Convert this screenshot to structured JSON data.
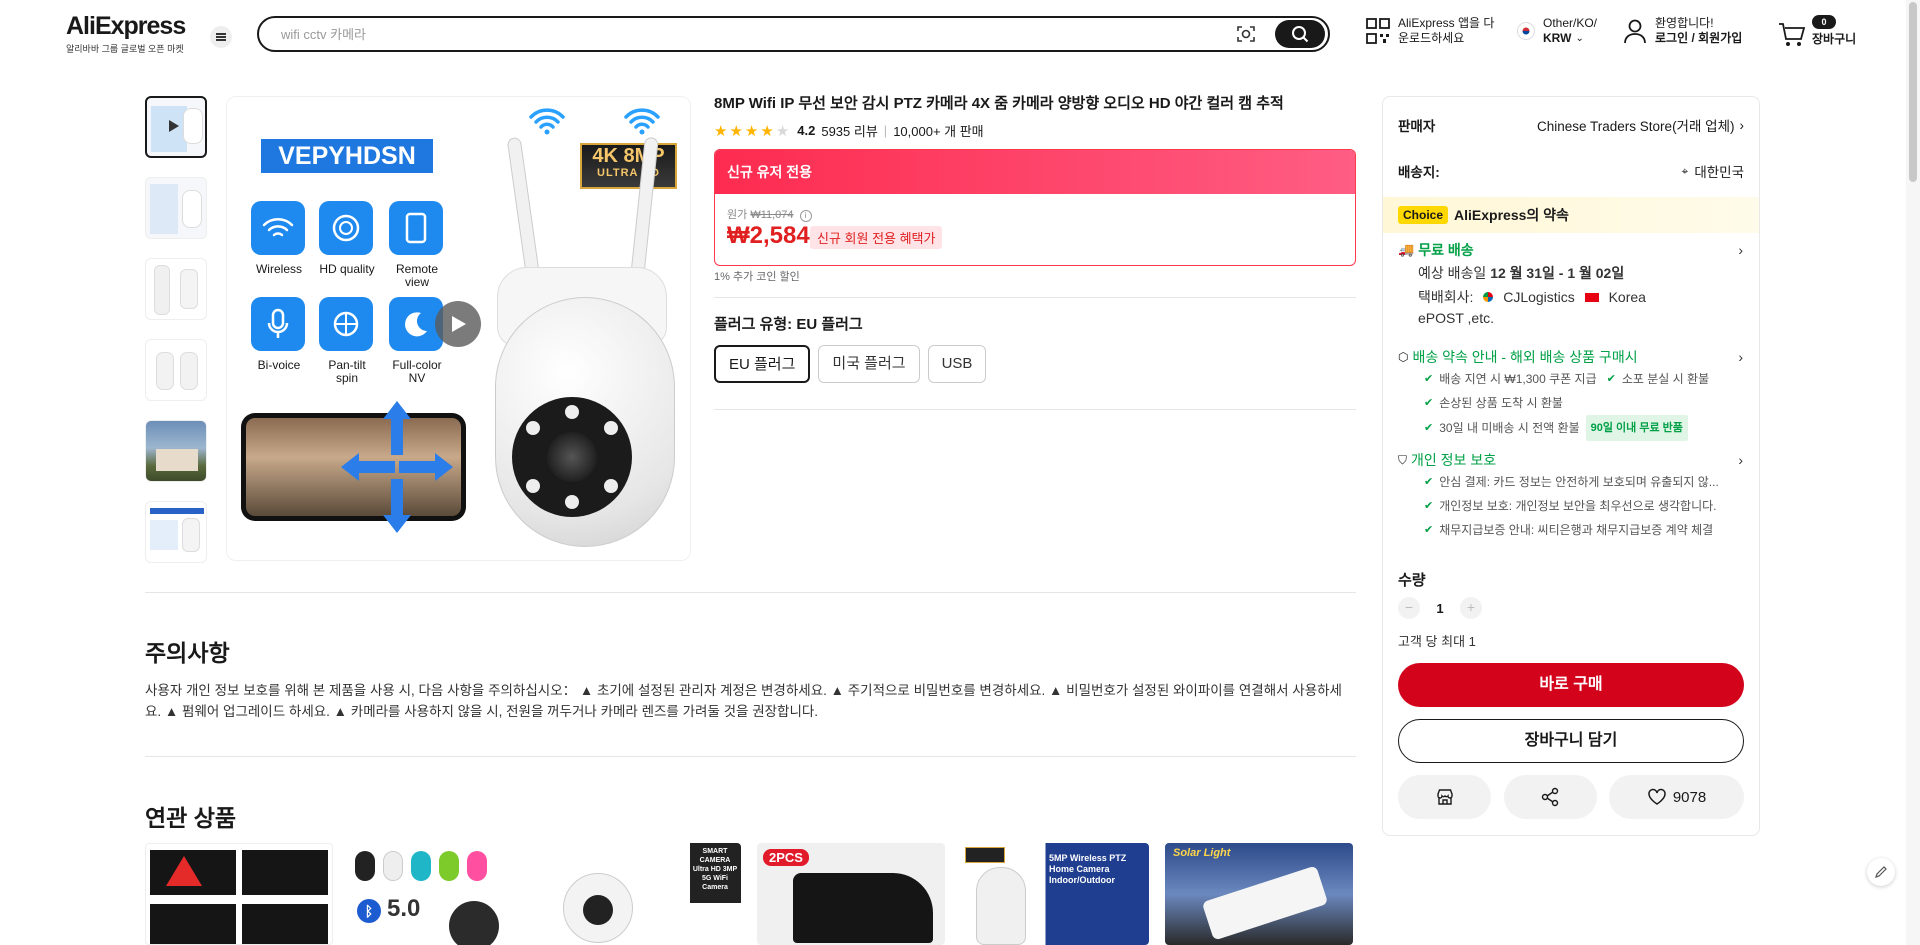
{
  "header": {
    "logo": "AliExpress",
    "logo_sub": "알리바바 그룹 글로벌 오픈 마켓",
    "search_placeholder": "wifi cctv 카메라",
    "app_line1": "AliExpress 앱을 다",
    "app_line2": "운로드하세요",
    "region_line1": "Other/KO/",
    "region_line2": "KRW",
    "account_line1": "환영합니다!",
    "account_line2": "로그인 / 회원가입",
    "cart_count": "0",
    "cart_label": "장바구니"
  },
  "gallery": {
    "brand": "VEPYHDSN",
    "badge_line1": "4K 8MP",
    "badge_line2": "ULTRA HD",
    "features": [
      "Wireless",
      "HD quality",
      "Remote view",
      "Bi-voice",
      "Pan-tilt spin",
      "Full-color NV"
    ]
  },
  "product": {
    "title": "8MP Wifi IP 무선 보안 감시 PTZ 카메라 4X 줌 카메라 양방향 오디오 HD 야간 컬러 캠 추적",
    "rating": "4.2",
    "rating_stars": 4,
    "reviews": "5935 리뷰",
    "sold": "10,000+ 개 판매",
    "promo_header": "신규 유저 전용",
    "orig_label": "원가",
    "orig_price": "₩11,074",
    "price": "₩2,584",
    "promo_tag": "신규 회원 전용 혜택가",
    "coin_note": "1% 추가 코인 할인",
    "plug_label": "플러그 유형: EU 플러그",
    "plug_options": [
      "EU 플러그",
      "미국 플러그",
      "USB"
    ],
    "plug_selected": 0
  },
  "notice": {
    "title": "주의사항",
    "text": "사용자 개인 정보 보호를 위해 본 제품을 사용 시, 다음 사항을 주의하십시오： ▲ 초기에 설정된 관리자 계정은 변경하세요. ▲ 주기적으로 비밀번호를 변경하세요. ▲ 비밀번호가 설정된 와이파이를 연결해서 사용하세요. ▲ 펌웨어 업그레이드 하세요. ▲ 카메라를 사용하지 않을 시, 전원을 꺼두거나 카메라 렌즈를 가려둘 것을 권장합니다."
  },
  "related": {
    "title": "연관 상품",
    "card_labels": [
      "",
      "5.0",
      "SMART CAMERA Ultra HD 3MP 5G WiFi Camera",
      "2PCS",
      "5MP Wireless PTZ Home Camera Indoor/Outdoor",
      "Solar Light"
    ]
  },
  "panel": {
    "seller_label": "판매자",
    "seller_name": "Chinese Traders Store(거래 업체)",
    "shipto_label": "배송지:",
    "shipto_value": "대한민국",
    "choice_badge": "Choice",
    "choice_text": "AliExpress의 약속",
    "free_ship": "무료 배송",
    "eta_prefix": "예상 배송일 ",
    "eta_dates": "12 월 31일 - 1 월 02일",
    "carrier_prefix": "택배회사:",
    "carrier1": "CJLogistics",
    "carrier2": "Korea",
    "carrier3": "ePOST ,etc.",
    "promise_title": "배송 약속 안내 - 해외 배송 상품 구매시",
    "promise_items": [
      "배송 지연 시 ₩1,300 쿠폰 지급",
      "소포 분실 시 환불",
      "손상된 상품 도착 시 환불",
      "30일 내 미배송 시 전액 환불"
    ],
    "promise_tag": "90일 이내 무료 반품",
    "privacy_title": "개인 정보 보호",
    "privacy_items": [
      "안심 결제: 카드 정보는 안전하게 보호되며 유출되지 않...",
      "개인정보 보호: 개인정보 보안을 최우선으로 생각합니다.",
      "채무지급보증 안내: 씨티은행과 채무지급보증 계약 체결"
    ],
    "qty_label": "수량",
    "qty_value": "1",
    "qty_max": "고객 당 최대 1",
    "buy_now": "바로 구매",
    "add_cart": "장바구니 담기",
    "wishlist_count": "9078"
  }
}
